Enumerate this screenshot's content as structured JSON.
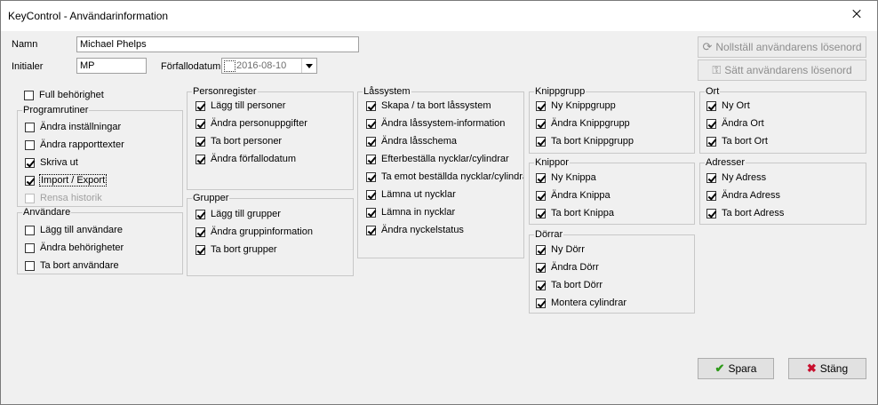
{
  "window": {
    "title": "KeyControl - Användarinformation"
  },
  "form": {
    "name_label": "Namn",
    "name_value": "Michael Phelps",
    "initials_label": "Initialer",
    "initials_value": "MP",
    "expiry_label": "Förfallodatum",
    "expiry_value": "2016-08-10"
  },
  "buttons": {
    "reset_password": "Nollställ användarens lösenord",
    "set_password": "Sätt användarens lösenord",
    "save": "Spara",
    "close": "Stäng"
  },
  "full_access": {
    "label": "Full behörighet",
    "checked": false
  },
  "groups": {
    "programrutiner": {
      "title": "Programrutiner",
      "items": [
        {
          "label": "Ändra inställningar",
          "checked": false
        },
        {
          "label": "Ändra rapporttexter",
          "checked": false
        },
        {
          "label": "Skriva ut",
          "checked": true
        },
        {
          "label": "Import / Export",
          "checked": true
        },
        {
          "label": "Rensa historik",
          "checked": false,
          "disabled": true
        }
      ]
    },
    "anvandare": {
      "title": "Användare",
      "items": [
        {
          "label": "Lägg till användare",
          "checked": false
        },
        {
          "label": "Ändra behörigheter",
          "checked": false
        },
        {
          "label": "Ta bort användare",
          "checked": false
        }
      ]
    },
    "personregister": {
      "title": "Personregister",
      "items": [
        {
          "label": "Lägg till personer",
          "checked": true
        },
        {
          "label": "Ändra personuppgifter",
          "checked": true
        },
        {
          "label": "Ta bort personer",
          "checked": true
        },
        {
          "label": "Ändra förfallodatum",
          "checked": true
        }
      ]
    },
    "grupper": {
      "title": "Grupper",
      "items": [
        {
          "label": "Lägg till grupper",
          "checked": true
        },
        {
          "label": "Ändra gruppinformation",
          "checked": true
        },
        {
          "label": "Ta bort grupper",
          "checked": true
        }
      ]
    },
    "lassystem": {
      "title": "Låssystem",
      "items": [
        {
          "label": "Skapa / ta bort låssystem",
          "checked": true
        },
        {
          "label": "Ändra låssystem-information",
          "checked": true
        },
        {
          "label": "Ändra låsschema",
          "checked": true
        },
        {
          "label": "Efterbeställa nycklar/cylindrar",
          "checked": true
        },
        {
          "label": "Ta emot beställda nycklar/cylindrar",
          "checked": true
        },
        {
          "label": "Lämna ut nycklar",
          "checked": true
        },
        {
          "label": "Lämna in nycklar",
          "checked": true
        },
        {
          "label": "Ändra nyckelstatus",
          "checked": true
        }
      ]
    },
    "knippgrupp": {
      "title": "Knippgrupp",
      "items": [
        {
          "label": "Ny Knippgrupp",
          "checked": true
        },
        {
          "label": "Ändra Knippgrupp",
          "checked": true
        },
        {
          "label": "Ta bort Knippgrupp",
          "checked": true
        }
      ]
    },
    "knippor": {
      "title": "Knippor",
      "items": [
        {
          "label": "Ny Knippa",
          "checked": true
        },
        {
          "label": "Ändra Knippa",
          "checked": true
        },
        {
          "label": "Ta bort Knippa",
          "checked": true
        }
      ]
    },
    "dorrar": {
      "title": "Dörrar",
      "items": [
        {
          "label": "Ny Dörr",
          "checked": true
        },
        {
          "label": "Ändra Dörr",
          "checked": true
        },
        {
          "label": "Ta bort Dörr",
          "checked": true
        },
        {
          "label": "Montera cylindrar",
          "checked": true
        }
      ]
    },
    "ort": {
      "title": "Ort",
      "items": [
        {
          "label": "Ny Ort",
          "checked": true
        },
        {
          "label": "Ändra Ort",
          "checked": true
        },
        {
          "label": "Ta bort Ort",
          "checked": true
        }
      ]
    },
    "adresser": {
      "title": "Adresser",
      "items": [
        {
          "label": "Ny Adress",
          "checked": true
        },
        {
          "label": "Ändra Adress",
          "checked": true
        },
        {
          "label": "Ta bort Adress",
          "checked": true
        }
      ]
    }
  }
}
